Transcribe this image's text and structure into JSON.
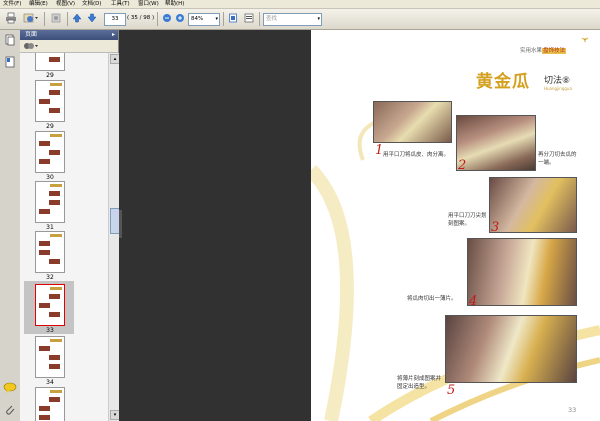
{
  "menu": [
    "文件(F)",
    "编辑(E)",
    "视图(V)",
    "文档(D)",
    "工具(T)",
    "窗口(W)",
    "帮助(H)"
  ],
  "toolbar": {
    "page_current": "33",
    "page_total": "( 35 / 98 )",
    "zoom": "84%",
    "find_placeholder": "查找"
  },
  "panel": {
    "title": "页面"
  },
  "thumbnails": [
    {
      "label": "29",
      "selected": false
    },
    {
      "label": "29",
      "selected": false
    },
    {
      "label": "30",
      "selected": false
    },
    {
      "label": "31",
      "selected": false
    },
    {
      "label": "32",
      "selected": false
    },
    {
      "label": "33",
      "selected": true
    },
    {
      "label": "34",
      "selected": false
    },
    {
      "label": "",
      "selected": false
    }
  ],
  "doc": {
    "header": "实用水果",
    "header_highlight": "盘饰技法",
    "title": "黄金瓜",
    "title_suffix": "切法⑧",
    "subtitle": "Huangjinggua",
    "steps": [
      {
        "num": "1",
        "text": "用平口刀将瓜皮、肉分离。"
      },
      {
        "num": "2",
        "text": "再分刀切去瓜的一端。"
      },
      {
        "num": "3",
        "text": "用平口刀刀尖划刻图案。"
      },
      {
        "num": "4",
        "text": "将瓜肉切出一薄片。"
      },
      {
        "num": "5",
        "text": "将薄片刻成图案并固定出造型。"
      }
    ],
    "page_number": "33"
  }
}
